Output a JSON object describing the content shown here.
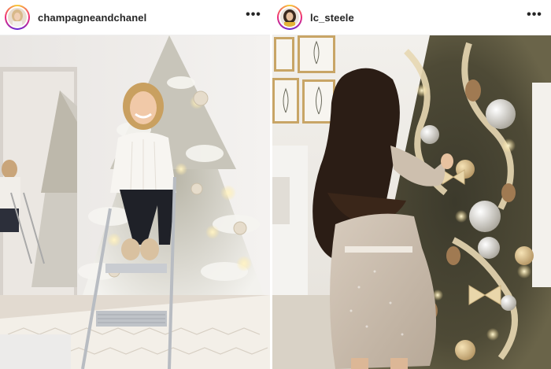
{
  "posts": [
    {
      "username": "champagneandchanel",
      "more_icon": "more-horizontal-icon",
      "more_label": "•••",
      "photo_subject": ""
    },
    {
      "username": "lc_steele",
      "more_icon": "more-horizontal-icon",
      "more_label": "•••",
      "photo_subject": ""
    }
  ],
  "colors": {
    "username_text": "#262626",
    "header_border": "#efefef",
    "avatar_ring": [
      "#f9ce34",
      "#ee2a7b",
      "#6228d7"
    ]
  }
}
